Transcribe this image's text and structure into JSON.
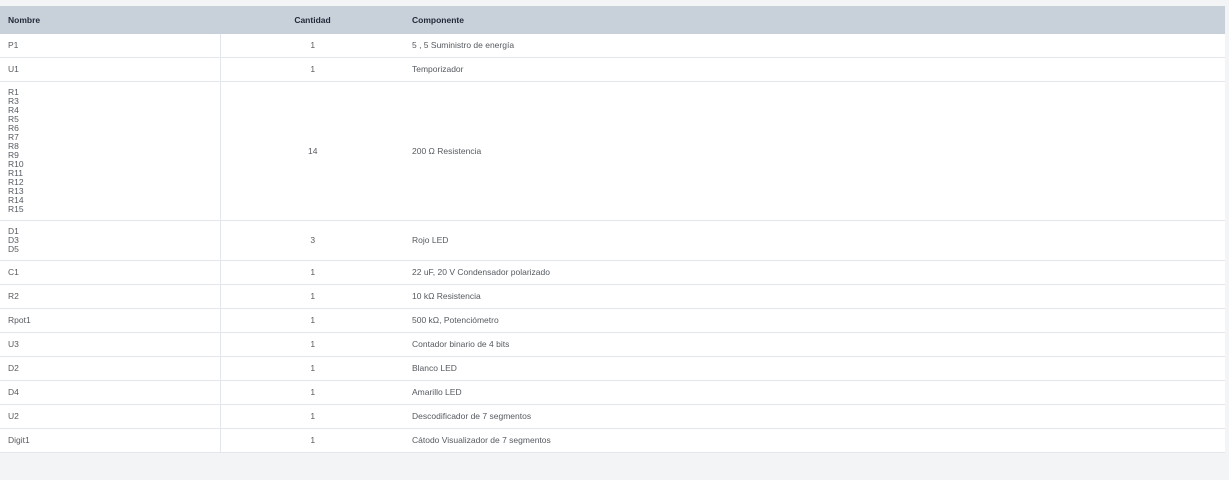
{
  "table": {
    "headers": {
      "name": "Nombre",
      "quantity": "Cantidad",
      "component": "Componente"
    },
    "rows": [
      {
        "names": [
          "P1"
        ],
        "quantity": "1",
        "component": "5 , 5 Suministro de energía"
      },
      {
        "names": [
          "U1"
        ],
        "quantity": "1",
        "component": "Temporizador"
      },
      {
        "names": [
          "R1",
          "R3",
          "R4",
          "R5",
          "R6",
          "R7",
          "R8",
          "R9",
          "R10",
          "R11",
          "R12",
          "R13",
          "R14",
          "R15"
        ],
        "quantity": "14",
        "component": "200 Ω Resistencia"
      },
      {
        "names": [
          "D1",
          "D3",
          "D5"
        ],
        "quantity": "3",
        "component": "Rojo LED"
      },
      {
        "names": [
          "C1"
        ],
        "quantity": "1",
        "component": "22 uF, 20 V Condensador polarizado"
      },
      {
        "names": [
          "R2"
        ],
        "quantity": "1",
        "component": "10 kΩ Resistencia"
      },
      {
        "names": [
          "Rpot1"
        ],
        "quantity": "1",
        "component": "500 kΩ, Potenciómetro"
      },
      {
        "names": [
          "U3"
        ],
        "quantity": "1",
        "component": "Contador binario de 4 bits"
      },
      {
        "names": [
          "D2"
        ],
        "quantity": "1",
        "component": "Blanco LED"
      },
      {
        "names": [
          "D4"
        ],
        "quantity": "1",
        "component": "Amarillo LED"
      },
      {
        "names": [
          "U2"
        ],
        "quantity": "1",
        "component": "Descodificador de 7 segmentos"
      },
      {
        "names": [
          "Digit1"
        ],
        "quantity": "1",
        "component": "Cátodo Visualizador de 7 segmentos"
      }
    ]
  },
  "colors": {
    "header_bg": "#c8d0da",
    "row_border": "#e3e6ea",
    "page_bg": "#f3f4f6"
  }
}
